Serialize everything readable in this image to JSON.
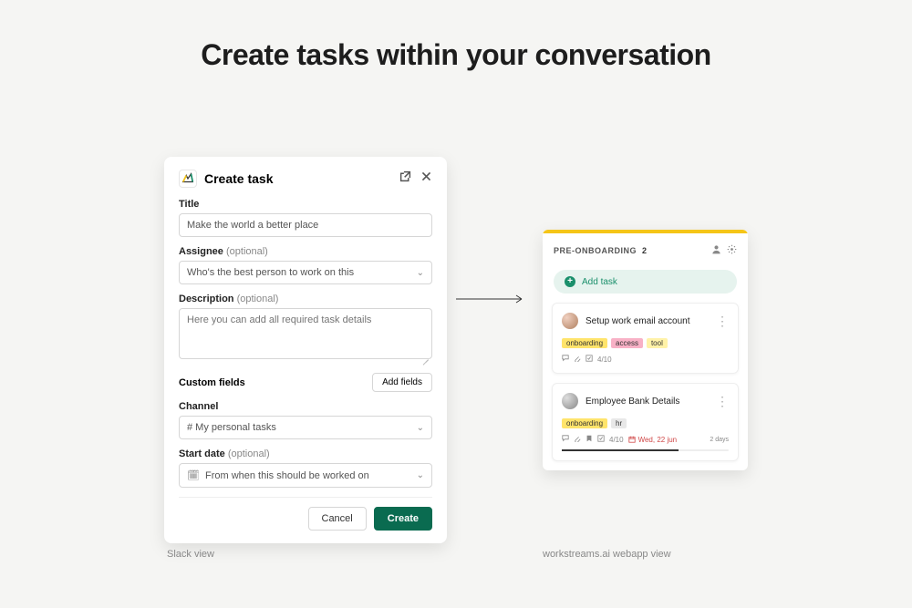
{
  "heading": "Create tasks within your conversation",
  "slack": {
    "modal_title": "Create task",
    "title_label": "Title",
    "title_value": "Make the world a better place",
    "assignee_label": "Assignee",
    "assignee_opt": "(optional)",
    "assignee_placeholder": "Who's the best person to work on this",
    "description_label": "Description",
    "description_opt": "(optional)",
    "description_placeholder": "Here you can add all required task details",
    "custom_fields_label": "Custom fields",
    "add_fields": "Add fields",
    "channel_label": "Channel",
    "channel_value": "# My personal tasks",
    "startdate_label": "Start date",
    "startdate_opt": "(optional)",
    "startdate_placeholder": "From when this should be worked on",
    "cancel": "Cancel",
    "create": "Create"
  },
  "captions": {
    "left": "Slack view",
    "right": "workstreams.ai webapp view"
  },
  "board": {
    "title": "PRE-ONBOARDING",
    "count": "2",
    "add_task": "Add task",
    "cards": [
      {
        "title": "Setup work email account",
        "tags": [
          "onboarding",
          "access",
          "tool"
        ],
        "progress": "4/10"
      },
      {
        "title": "Employee Bank Details",
        "tags": [
          "onboarding",
          "hr"
        ],
        "progress": "4/10",
        "due": "Wed, 22 jun",
        "days": "2 days"
      }
    ]
  }
}
